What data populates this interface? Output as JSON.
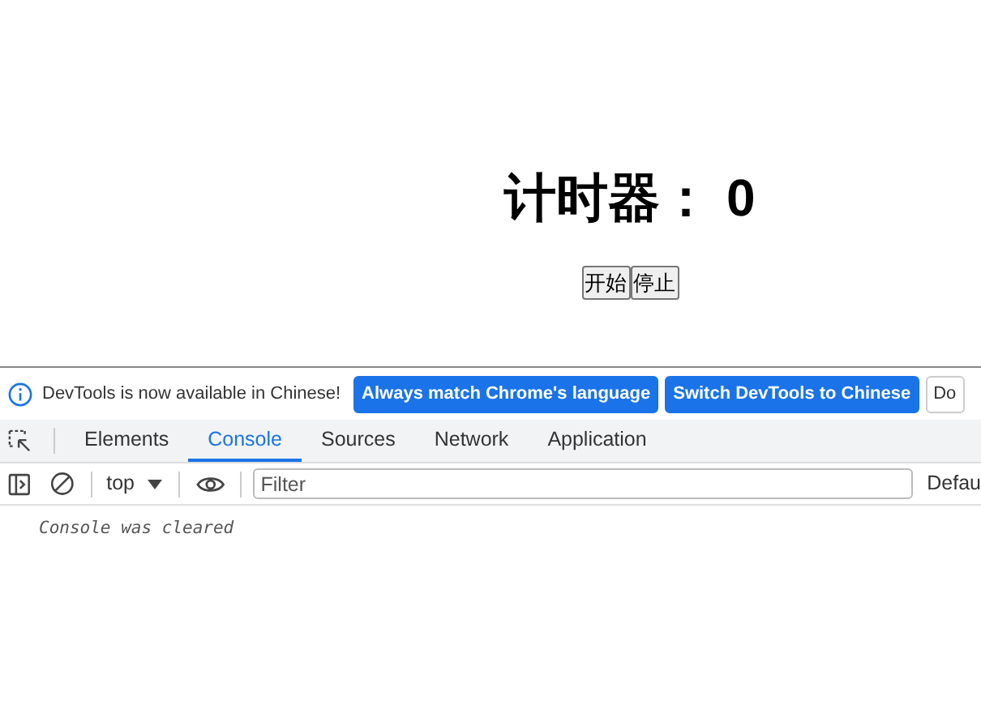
{
  "page": {
    "heading": "计时器： 0",
    "buttons": [
      {
        "label": "开始"
      },
      {
        "label": "停止"
      }
    ]
  },
  "devtools": {
    "infobar": {
      "message": "DevTools is now available in Chinese!",
      "buttons": [
        {
          "label": "Always match Chrome's language",
          "kind": "primary"
        },
        {
          "label": "Switch DevTools to Chinese",
          "kind": "primary"
        },
        {
          "label": "Do",
          "kind": "plain"
        }
      ]
    },
    "tabs": [
      {
        "label": "Elements",
        "selected": false
      },
      {
        "label": "Console",
        "selected": true
      },
      {
        "label": "Sources",
        "selected": false
      },
      {
        "label": "Network",
        "selected": false
      },
      {
        "label": "Application",
        "selected": false
      }
    ],
    "toolbar": {
      "context": "top",
      "filter_placeholder": "Filter",
      "levels": "Defau"
    },
    "console": [
      {
        "text": "Console was cleared"
      }
    ]
  }
}
